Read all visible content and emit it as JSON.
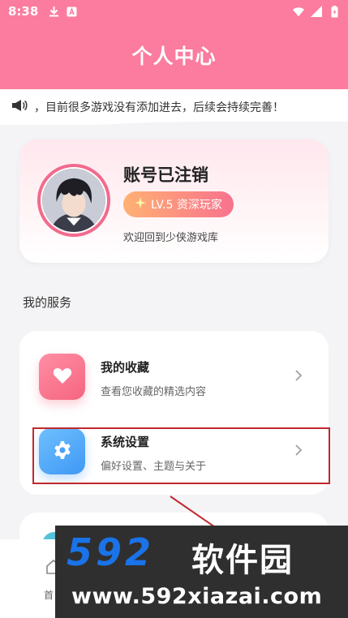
{
  "status_bar": {
    "time": "8:38"
  },
  "header": {
    "title": "个人中心"
  },
  "notice": {
    "text": "，目前很多游戏没有添加进去，后续会持续完善！"
  },
  "profile": {
    "username": "账号已注销",
    "level": "LV.5 资深玩家",
    "welcome": "欢迎回到少侠游戏库"
  },
  "services": {
    "section_title": "我的服务",
    "items": [
      {
        "title": "我的收藏",
        "desc": "查看您收藏的精选内容",
        "icon": "heart-icon",
        "color": "#f5657f"
      },
      {
        "title": "系统设置",
        "desc": "偏好设置、主题与关于",
        "icon": "gear-icon",
        "color": "#3f98f4"
      }
    ]
  },
  "bottom_nav": {
    "home_label": "首"
  },
  "watermark": {
    "logo_num": "592",
    "logo_cn": "软件园",
    "url": "www.592xiazai.com"
  },
  "colors": {
    "header": "#fb7c9e",
    "highlight": "#c0282e"
  }
}
